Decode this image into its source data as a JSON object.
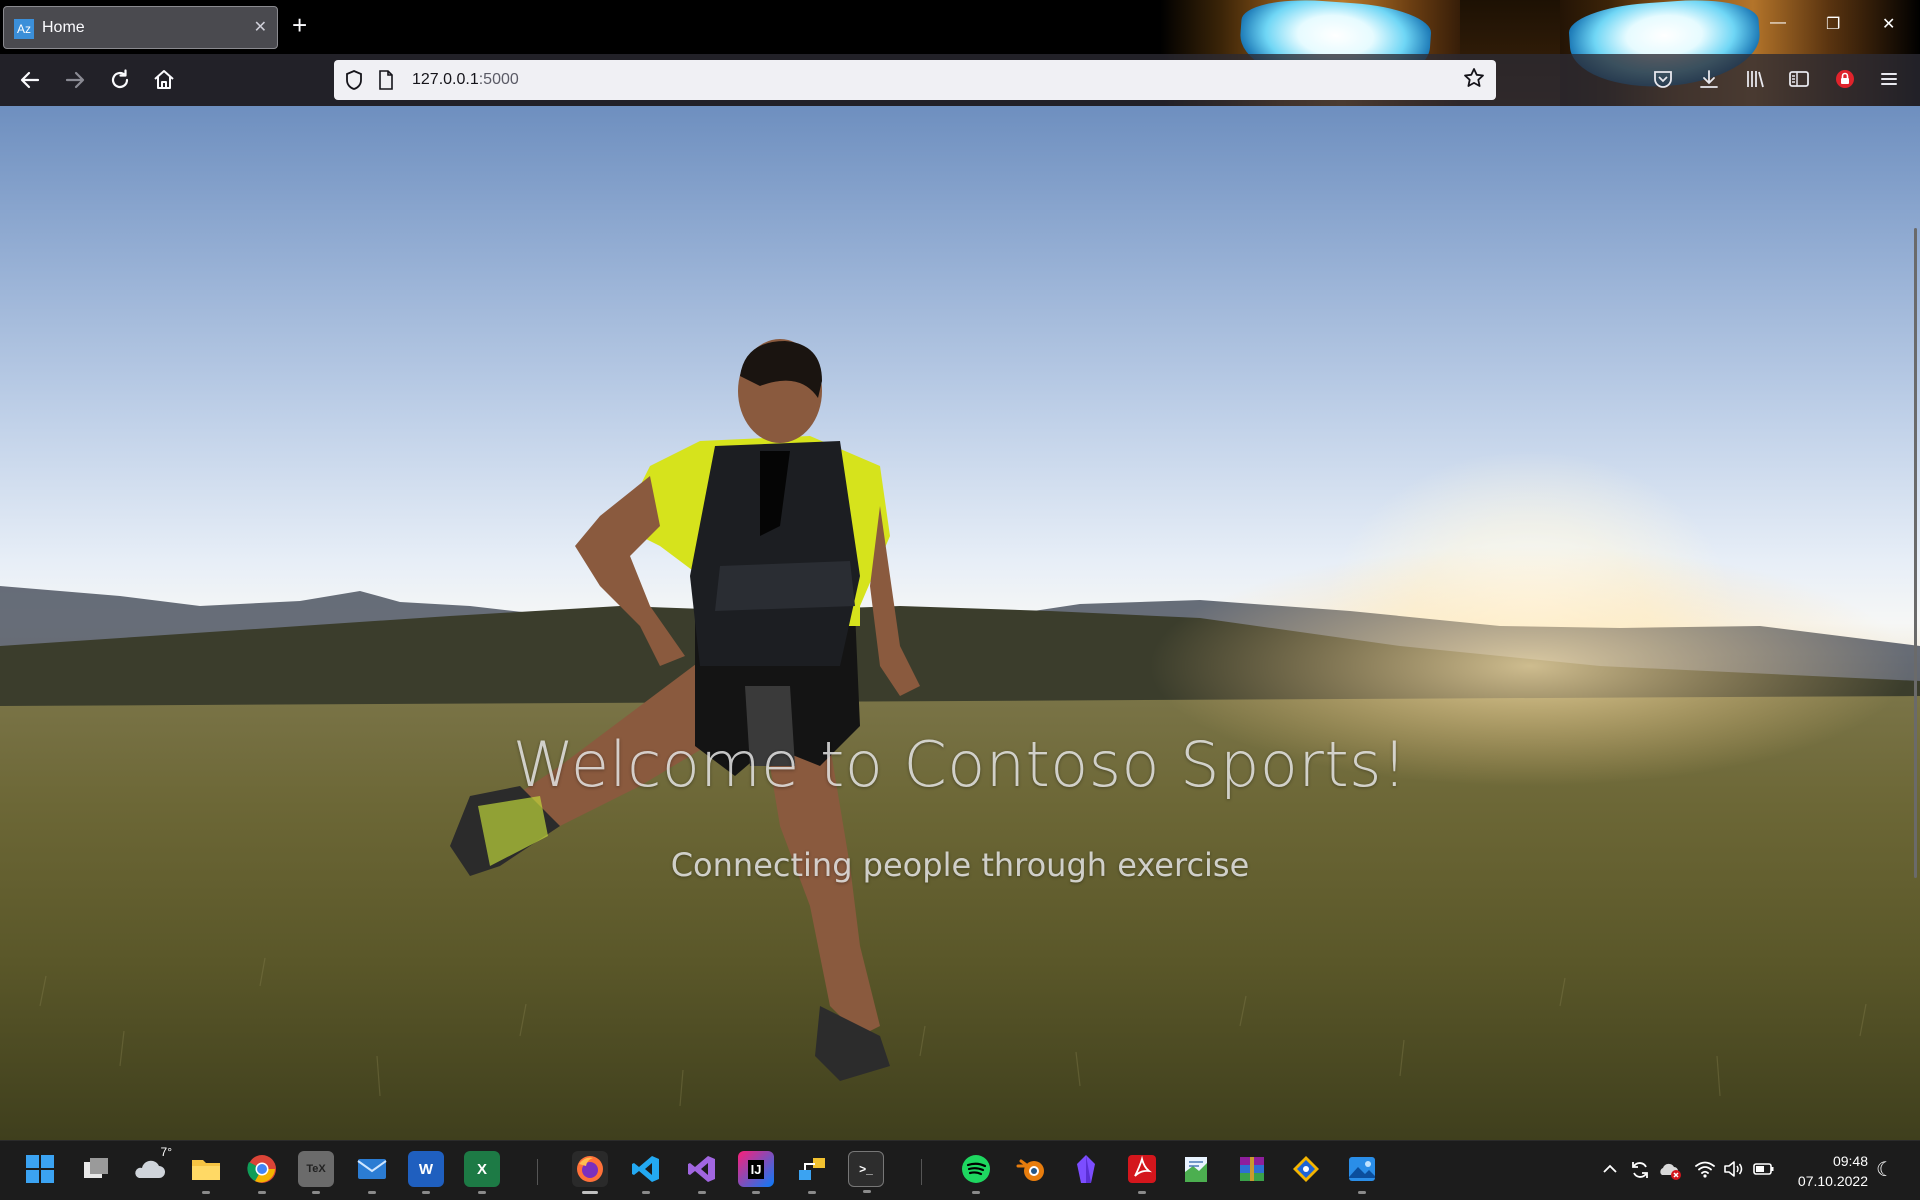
{
  "browser": {
    "tab": {
      "favicon_text": "Az",
      "title": "Home",
      "close_glyph": "✕"
    },
    "new_tab_glyph": "+",
    "window_controls": {
      "minimize": "—",
      "restore": "❐",
      "close": "✕"
    },
    "nav": {
      "back": "back-arrow-icon",
      "forward": "forward-arrow-icon",
      "reload": "reload-icon",
      "home": "home-icon"
    },
    "url": {
      "host": "127.0.0.1",
      "port": ":5000"
    },
    "toolbar_icons": [
      "pocket-icon",
      "download-icon",
      "library-icon",
      "sidebar-icon",
      "extension-lock-icon",
      "menu-icon"
    ],
    "theme_colors": {
      "frame": "#000000",
      "url_bg": "#f0f0f4",
      "accent": "#3b8fd9"
    }
  },
  "page": {
    "heading": "Welcome to Contoso Sports!",
    "tagline": "Connecting people through exercise",
    "hero_image": "runner-in-meadow-at-sunset"
  },
  "taskbar": {
    "weather_temp": "7°",
    "apps": [
      {
        "name": "start",
        "label": ""
      },
      {
        "name": "task-view",
        "label": ""
      },
      {
        "name": "weather",
        "label": ""
      },
      {
        "name": "file-explorer",
        "label": ""
      },
      {
        "name": "chrome",
        "label": ""
      },
      {
        "name": "texmaker",
        "label": "TeX"
      },
      {
        "name": "mail",
        "label": ""
      },
      {
        "name": "word",
        "label": "W"
      },
      {
        "name": "excel",
        "label": "X"
      },
      {
        "name": "firefox",
        "label": ""
      },
      {
        "name": "vscode",
        "label": ""
      },
      {
        "name": "visual-studio",
        "label": ""
      },
      {
        "name": "jetbrains",
        "label": "IJ"
      },
      {
        "name": "network-tool",
        "label": ""
      },
      {
        "name": "terminal",
        "label": ">_"
      },
      {
        "name": "spotify",
        "label": ""
      },
      {
        "name": "blender",
        "label": ""
      },
      {
        "name": "obsidian",
        "label": ""
      },
      {
        "name": "acrobat",
        "label": ""
      },
      {
        "name": "notepad",
        "label": ""
      },
      {
        "name": "winrar",
        "label": ""
      },
      {
        "name": "git-tool",
        "label": ""
      },
      {
        "name": "photos",
        "label": ""
      }
    ],
    "tray": [
      "chevron-up-icon",
      "sync-icon",
      "onedrive-error-icon",
      "wifi-icon",
      "volume-icon",
      "battery-icon"
    ],
    "time": "09:48",
    "date": "07.10.2022",
    "focus_glyph": "☾"
  }
}
